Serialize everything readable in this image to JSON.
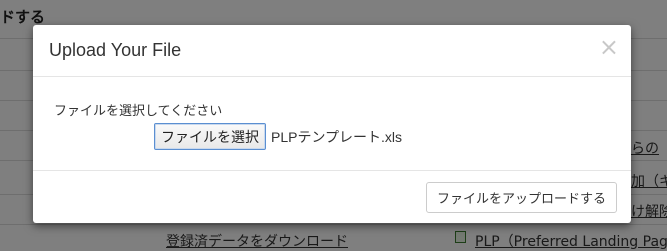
{
  "background": {
    "heading": "ドする",
    "right_links": [
      "らの",
      "加（キ",
      "け解除"
    ],
    "bottom_link": "登録済データをダウンロード",
    "bottom_file_link": "PLP（Preferred Landing Page"
  },
  "modal": {
    "title": "Upload Your File",
    "close_label": "×",
    "field_label": "ファイルを選択してください",
    "file_button_label": "ファイルを選択",
    "file_name": "PLPテンプレート.xls",
    "upload_button_label": "ファイルをアップロードする"
  }
}
